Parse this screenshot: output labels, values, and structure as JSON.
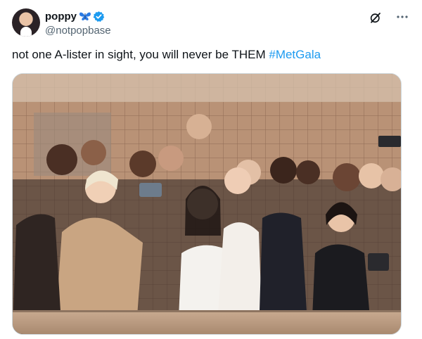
{
  "user": {
    "display_name": "poppy",
    "handle": "@notpopbase",
    "badge_emoji": "butterfly-icon",
    "verified": true
  },
  "tweet": {
    "text_plain": "not one A-lister in sight, you will never be THEM ",
    "hashtag": "#MetGala"
  },
  "icons": {
    "grok": "grok-icon",
    "more": "more-icon"
  },
  "media": {
    "alt": "Group mirror selfie of celebrities in a tiled bathroom"
  },
  "colors": {
    "link": "#1d9bf0",
    "secondary_text": "#536471",
    "verified": "#1d9bf0",
    "butterfly": "#2b7be4"
  }
}
